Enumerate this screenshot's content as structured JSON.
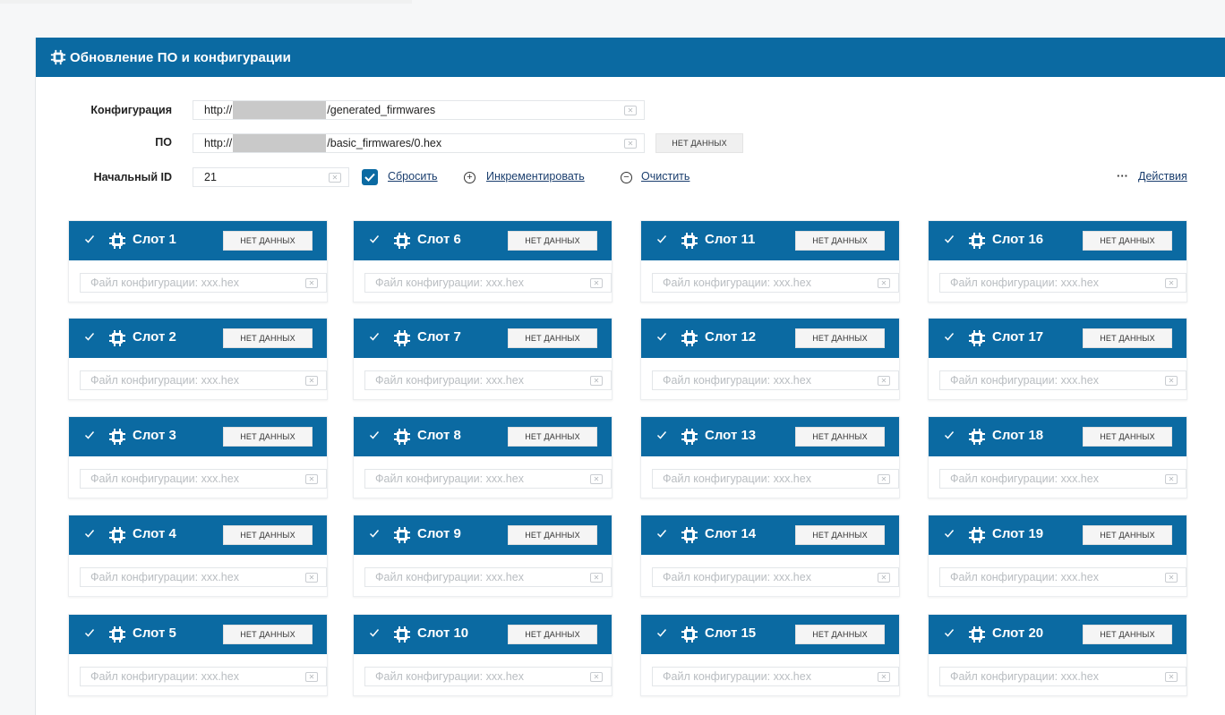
{
  "panel": {
    "title": "Обновление ПО и конфигурации",
    "icon": "chip-icon"
  },
  "form": {
    "config": {
      "label": "Конфигурация",
      "prefix": "http://",
      "suffix": "/generated_firmwares"
    },
    "firmware": {
      "label": "ПО",
      "prefix": "http://",
      "suffix": "/basic_firmwares/0.hex",
      "status": "НЕТ ДАННЫХ"
    },
    "start_id": {
      "label": "Начальный ID",
      "value": "21"
    },
    "reset_label": "Сбросить",
    "increment_label": "Инкрементировать",
    "clear_label": "Очистить",
    "actions_label": "Действия"
  },
  "slots": [
    {
      "title": "Слот 1",
      "status": "НЕТ ДАННЫХ",
      "placeholder": "Файл конфигурации: xxx.hex"
    },
    {
      "title": "Слот 2",
      "status": "НЕТ ДАННЫХ",
      "placeholder": "Файл конфигурации: xxx.hex"
    },
    {
      "title": "Слот 3",
      "status": "НЕТ ДАННЫХ",
      "placeholder": "Файл конфигурации: xxx.hex"
    },
    {
      "title": "Слот 4",
      "status": "НЕТ ДАННЫХ",
      "placeholder": "Файл конфигурации: xxx.hex"
    },
    {
      "title": "Слот 5",
      "status": "НЕТ ДАННЫХ",
      "placeholder": "Файл конфигурации: xxx.hex"
    },
    {
      "title": "Слот 6",
      "status": "НЕТ ДАННЫХ",
      "placeholder": "Файл конфигурации: xxx.hex"
    },
    {
      "title": "Слот 7",
      "status": "НЕТ ДАННЫХ",
      "placeholder": "Файл конфигурации: xxx.hex"
    },
    {
      "title": "Слот 8",
      "status": "НЕТ ДАННЫХ",
      "placeholder": "Файл конфигурации: xxx.hex"
    },
    {
      "title": "Слот 9",
      "status": "НЕТ ДАННЫХ",
      "placeholder": "Файл конфигурации: xxx.hex"
    },
    {
      "title": "Слот 10",
      "status": "НЕТ ДАННЫХ",
      "placeholder": "Файл конфигурации: xxx.hex"
    },
    {
      "title": "Слот 11",
      "status": "НЕТ ДАННЫХ",
      "placeholder": "Файл конфигурации: xxx.hex"
    },
    {
      "title": "Слот 12",
      "status": "НЕТ ДАННЫХ",
      "placeholder": "Файл конфигурации: xxx.hex"
    },
    {
      "title": "Слот 13",
      "status": "НЕТ ДАННЫХ",
      "placeholder": "Файл конфигурации: xxx.hex"
    },
    {
      "title": "Слот 14",
      "status": "НЕТ ДАННЫХ",
      "placeholder": "Файл конфигурации: xxx.hex"
    },
    {
      "title": "Слот 15",
      "status": "НЕТ ДАННЫХ",
      "placeholder": "Файл конфигурации: xxx.hex"
    },
    {
      "title": "Слот 16",
      "status": "НЕТ ДАННЫХ",
      "placeholder": "Файл конфигурации: xxx.hex"
    },
    {
      "title": "Слот 17",
      "status": "НЕТ ДАННЫХ",
      "placeholder": "Файл конфигурации: xxx.hex"
    },
    {
      "title": "Слот 18",
      "status": "НЕТ ДАННЫХ",
      "placeholder": "Файл конфигурации: xxx.hex"
    },
    {
      "title": "Слот 19",
      "status": "НЕТ ДАННЫХ",
      "placeholder": "Файл конфигурации: xxx.hex"
    },
    {
      "title": "Слот 20",
      "status": "НЕТ ДАННЫХ",
      "placeholder": "Файл конфигурации: xxx.hex"
    }
  ],
  "colors": {
    "accent": "#0b6aa2",
    "link": "#1a3e6e",
    "placeholder": "#b9bdc1"
  }
}
